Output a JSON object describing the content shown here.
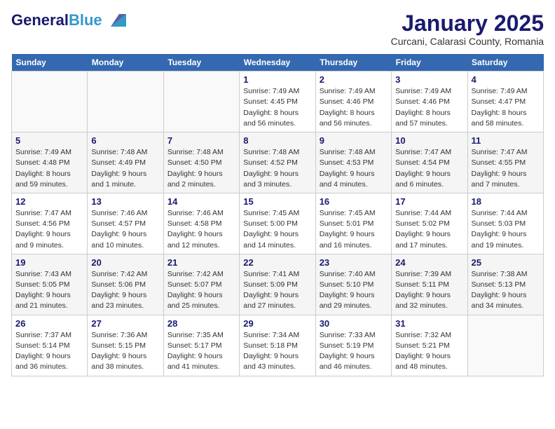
{
  "logo": {
    "general": "General",
    "blue": "Blue"
  },
  "title": "January 2025",
  "subtitle": "Curcani, Calarasi County, Romania",
  "days_of_week": [
    "Sunday",
    "Monday",
    "Tuesday",
    "Wednesday",
    "Thursday",
    "Friday",
    "Saturday"
  ],
  "weeks": [
    [
      {
        "day": "",
        "info": ""
      },
      {
        "day": "",
        "info": ""
      },
      {
        "day": "",
        "info": ""
      },
      {
        "day": "1",
        "info": "Sunrise: 7:49 AM\nSunset: 4:45 PM\nDaylight: 8 hours and 56 minutes."
      },
      {
        "day": "2",
        "info": "Sunrise: 7:49 AM\nSunset: 4:46 PM\nDaylight: 8 hours and 56 minutes."
      },
      {
        "day": "3",
        "info": "Sunrise: 7:49 AM\nSunset: 4:46 PM\nDaylight: 8 hours and 57 minutes."
      },
      {
        "day": "4",
        "info": "Sunrise: 7:49 AM\nSunset: 4:47 PM\nDaylight: 8 hours and 58 minutes."
      }
    ],
    [
      {
        "day": "5",
        "info": "Sunrise: 7:49 AM\nSunset: 4:48 PM\nDaylight: 8 hours and 59 minutes."
      },
      {
        "day": "6",
        "info": "Sunrise: 7:48 AM\nSunset: 4:49 PM\nDaylight: 9 hours and 1 minute."
      },
      {
        "day": "7",
        "info": "Sunrise: 7:48 AM\nSunset: 4:50 PM\nDaylight: 9 hours and 2 minutes."
      },
      {
        "day": "8",
        "info": "Sunrise: 7:48 AM\nSunset: 4:52 PM\nDaylight: 9 hours and 3 minutes."
      },
      {
        "day": "9",
        "info": "Sunrise: 7:48 AM\nSunset: 4:53 PM\nDaylight: 9 hours and 4 minutes."
      },
      {
        "day": "10",
        "info": "Sunrise: 7:47 AM\nSunset: 4:54 PM\nDaylight: 9 hours and 6 minutes."
      },
      {
        "day": "11",
        "info": "Sunrise: 7:47 AM\nSunset: 4:55 PM\nDaylight: 9 hours and 7 minutes."
      }
    ],
    [
      {
        "day": "12",
        "info": "Sunrise: 7:47 AM\nSunset: 4:56 PM\nDaylight: 9 hours and 9 minutes."
      },
      {
        "day": "13",
        "info": "Sunrise: 7:46 AM\nSunset: 4:57 PM\nDaylight: 9 hours and 10 minutes."
      },
      {
        "day": "14",
        "info": "Sunrise: 7:46 AM\nSunset: 4:58 PM\nDaylight: 9 hours and 12 minutes."
      },
      {
        "day": "15",
        "info": "Sunrise: 7:45 AM\nSunset: 5:00 PM\nDaylight: 9 hours and 14 minutes."
      },
      {
        "day": "16",
        "info": "Sunrise: 7:45 AM\nSunset: 5:01 PM\nDaylight: 9 hours and 16 minutes."
      },
      {
        "day": "17",
        "info": "Sunrise: 7:44 AM\nSunset: 5:02 PM\nDaylight: 9 hours and 17 minutes."
      },
      {
        "day": "18",
        "info": "Sunrise: 7:44 AM\nSunset: 5:03 PM\nDaylight: 9 hours and 19 minutes."
      }
    ],
    [
      {
        "day": "19",
        "info": "Sunrise: 7:43 AM\nSunset: 5:05 PM\nDaylight: 9 hours and 21 minutes."
      },
      {
        "day": "20",
        "info": "Sunrise: 7:42 AM\nSunset: 5:06 PM\nDaylight: 9 hours and 23 minutes."
      },
      {
        "day": "21",
        "info": "Sunrise: 7:42 AM\nSunset: 5:07 PM\nDaylight: 9 hours and 25 minutes."
      },
      {
        "day": "22",
        "info": "Sunrise: 7:41 AM\nSunset: 5:09 PM\nDaylight: 9 hours and 27 minutes."
      },
      {
        "day": "23",
        "info": "Sunrise: 7:40 AM\nSunset: 5:10 PM\nDaylight: 9 hours and 29 minutes."
      },
      {
        "day": "24",
        "info": "Sunrise: 7:39 AM\nSunset: 5:11 PM\nDaylight: 9 hours and 32 minutes."
      },
      {
        "day": "25",
        "info": "Sunrise: 7:38 AM\nSunset: 5:13 PM\nDaylight: 9 hours and 34 minutes."
      }
    ],
    [
      {
        "day": "26",
        "info": "Sunrise: 7:37 AM\nSunset: 5:14 PM\nDaylight: 9 hours and 36 minutes."
      },
      {
        "day": "27",
        "info": "Sunrise: 7:36 AM\nSunset: 5:15 PM\nDaylight: 9 hours and 38 minutes."
      },
      {
        "day": "28",
        "info": "Sunrise: 7:35 AM\nSunset: 5:17 PM\nDaylight: 9 hours and 41 minutes."
      },
      {
        "day": "29",
        "info": "Sunrise: 7:34 AM\nSunset: 5:18 PM\nDaylight: 9 hours and 43 minutes."
      },
      {
        "day": "30",
        "info": "Sunrise: 7:33 AM\nSunset: 5:19 PM\nDaylight: 9 hours and 46 minutes."
      },
      {
        "day": "31",
        "info": "Sunrise: 7:32 AM\nSunset: 5:21 PM\nDaylight: 9 hours and 48 minutes."
      },
      {
        "day": "",
        "info": ""
      }
    ]
  ]
}
